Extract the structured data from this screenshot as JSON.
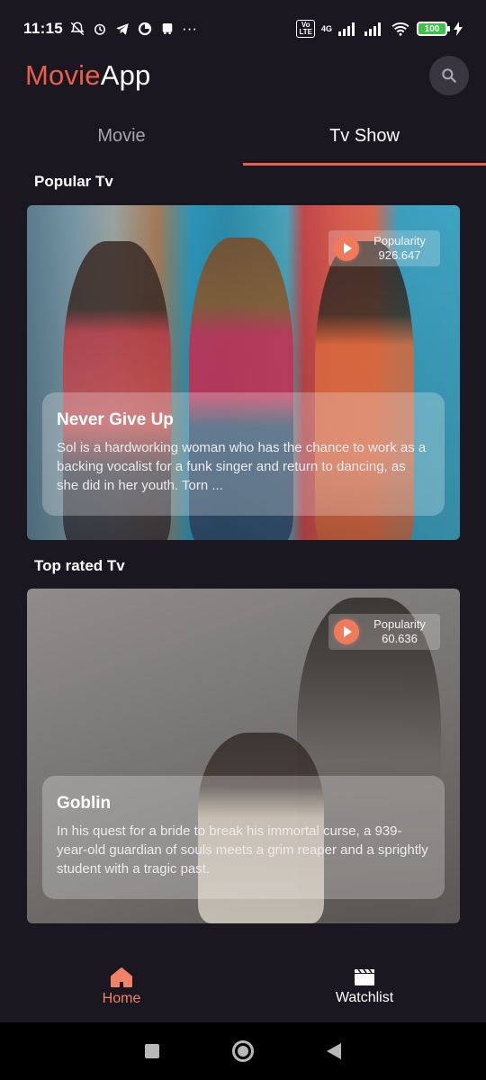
{
  "status_bar": {
    "time": "11:15",
    "left_icons": [
      "mute-icon",
      "alarm-icon",
      "telegram-icon",
      "data-saver-icon",
      "bus-icon"
    ],
    "more": "···",
    "network": "4G",
    "battery": "100"
  },
  "app": {
    "logo_accent": "Movie",
    "logo_rest": "App",
    "accent_color": "#e8604c"
  },
  "tabs": [
    {
      "label": "Movie",
      "active": false
    },
    {
      "label": "Tv Show",
      "active": true
    }
  ],
  "sections": {
    "popular": {
      "title": "Popular Tv",
      "card": {
        "popularity_label": "Popularity",
        "popularity_value": "926.647",
        "title": "Never Give Up",
        "description": "Sol is a hardworking woman who has the chance to work as a backing vocalist for a funk singer and return to dancing, as she did in her youth. Torn ..."
      }
    },
    "top_rated": {
      "title": "Top rated Tv",
      "card": {
        "popularity_label": "Popularity",
        "popularity_value": "60.636",
        "title": "Goblin",
        "description": "In his quest for a bride to break his immortal curse, a 939-year-old guardian of souls meets a grim reaper and a sprightly student with a tragic past."
      }
    }
  },
  "bottom_nav": [
    {
      "label": "Home",
      "icon": "home-icon",
      "active": true
    },
    {
      "label": "Watchlist",
      "icon": "clapperboard-icon",
      "active": false
    }
  ]
}
